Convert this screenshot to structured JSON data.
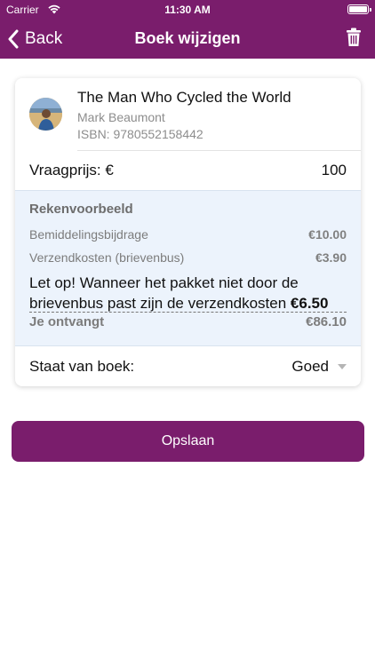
{
  "status_bar": {
    "carrier": "Carrier",
    "time": "11:30 AM"
  },
  "nav": {
    "back_label": "Back",
    "title": "Boek wijzigen",
    "delete_icon": "trash-icon"
  },
  "book": {
    "title": "The Man Who Cycled the World",
    "author": "Mark Beaumont",
    "isbn": "ISBN: 9780552158442"
  },
  "price": {
    "label": "Vraagprijs: €",
    "value": "100"
  },
  "calculation": {
    "heading": "Rekenvoorbeeld",
    "fee_label": "Bemiddelingsbijdrage",
    "fee_value": "€10.00",
    "shipping_label": "Verzendkosten (brievenbus)",
    "shipping_value": "€3.90",
    "warning_text": "Let op! Wanneer het pakket niet door de brievenbus past zijn de verzendkosten ",
    "warning_amount": "€6.50",
    "receive_label": "Je ontvangt",
    "receive_value": "€86.10"
  },
  "condition": {
    "label": "Staat van boek:",
    "value": "Goed"
  },
  "save_label": "Opslaan",
  "colors": {
    "brand": "#7a1d6c",
    "calc_background": "#ecf3fc"
  }
}
